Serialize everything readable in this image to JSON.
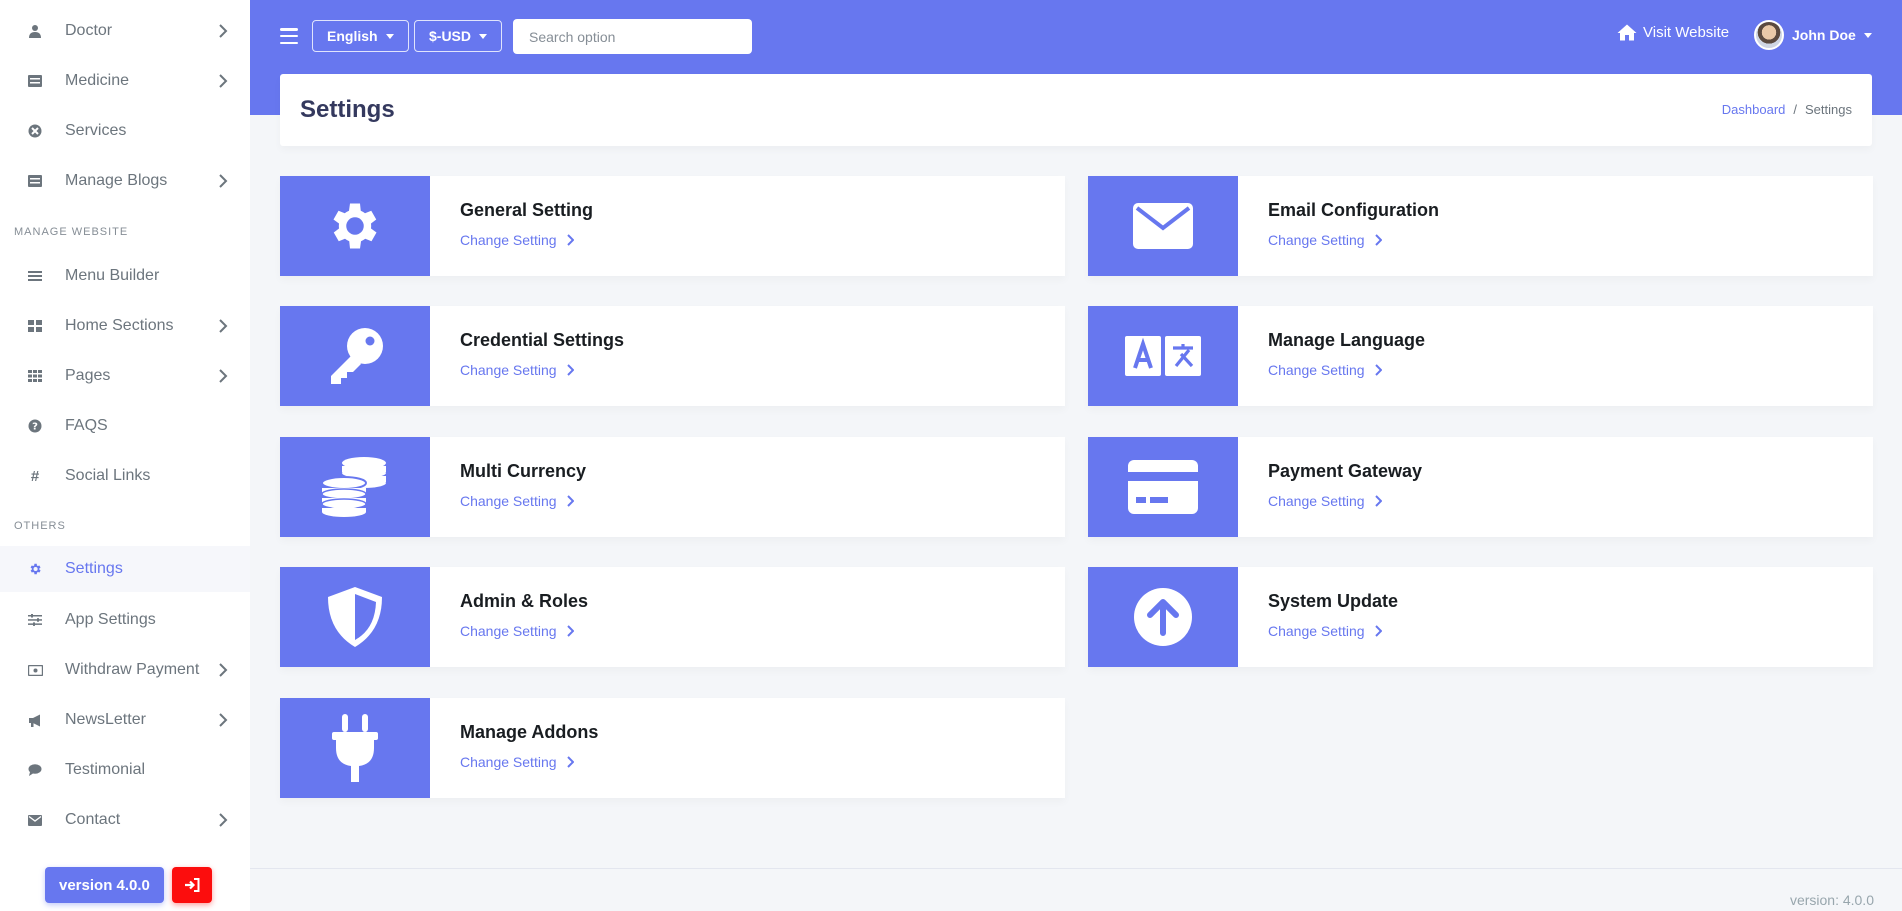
{
  "sidebar": {
    "items_top": [
      {
        "label": "Doctor",
        "icon": "doctor-icon",
        "has_submenu": true
      },
      {
        "label": "Medicine",
        "icon": "list-icon",
        "has_submenu": true
      },
      {
        "label": "Services",
        "icon": "services-icon",
        "has_submenu": false
      },
      {
        "label": "Manage Blogs",
        "icon": "blog-icon",
        "has_submenu": true
      }
    ],
    "header_website": "MANAGE WEBSITE",
    "items_website": [
      {
        "label": "Menu Builder",
        "icon": "bars-icon",
        "has_submenu": false
      },
      {
        "label": "Home Sections",
        "icon": "grid-icon",
        "has_submenu": true
      },
      {
        "label": "Pages",
        "icon": "pages-icon",
        "has_submenu": true
      },
      {
        "label": "FAQS",
        "icon": "question-icon",
        "has_submenu": false
      },
      {
        "label": "Social Links",
        "icon": "hash-icon",
        "has_submenu": false
      }
    ],
    "header_others": "OTHERS",
    "items_others": [
      {
        "label": "Settings",
        "icon": "gear-icon",
        "has_submenu": false,
        "active": true
      },
      {
        "label": "App Settings",
        "icon": "sliders-icon",
        "has_submenu": false
      },
      {
        "label": "Withdraw Payment",
        "icon": "money-icon",
        "has_submenu": true
      },
      {
        "label": "NewsLetter",
        "icon": "megaphone-icon",
        "has_submenu": true
      },
      {
        "label": "Testimonial",
        "icon": "comment-icon",
        "has_submenu": false
      },
      {
        "label": "Contact",
        "icon": "envelope-icon",
        "has_submenu": true
      }
    ],
    "version_label": "version 4.0.0"
  },
  "topbar": {
    "language": "English",
    "currency": "$-USD",
    "search_placeholder": "Search option",
    "visit_label": "Visit Website",
    "user_name": "John Doe"
  },
  "page": {
    "title": "Settings",
    "breadcrumb": [
      "Dashboard",
      "/",
      "Settings"
    ]
  },
  "cards": [
    {
      "title": "General Setting",
      "link": "Change Setting",
      "icon": "gear-icon"
    },
    {
      "title": "Email Configuration",
      "link": "Change Setting",
      "icon": "envelope-icon"
    },
    {
      "title": "Credential Settings",
      "link": "Change Setting",
      "icon": "key-icon"
    },
    {
      "title": "Manage Language",
      "link": "Change Setting",
      "icon": "language-icon"
    },
    {
      "title": "Multi Currency",
      "link": "Change Setting",
      "icon": "coins-icon"
    },
    {
      "title": "Payment Gateway",
      "link": "Change Setting",
      "icon": "credit-card-icon"
    },
    {
      "title": "Admin & Roles",
      "link": "Change Setting",
      "icon": "shield-icon"
    },
    {
      "title": "System Update",
      "link": "Change Setting",
      "icon": "arrow-up-circle-icon"
    },
    {
      "title": "Manage Addons",
      "link": "Change Setting",
      "icon": "plug-icon"
    }
  ],
  "footer": {
    "version": "version: 4.0.0"
  },
  "colors": {
    "primary": "#6777ef",
    "danger": "#fc0d0d",
    "background": "#f4f6f9"
  }
}
